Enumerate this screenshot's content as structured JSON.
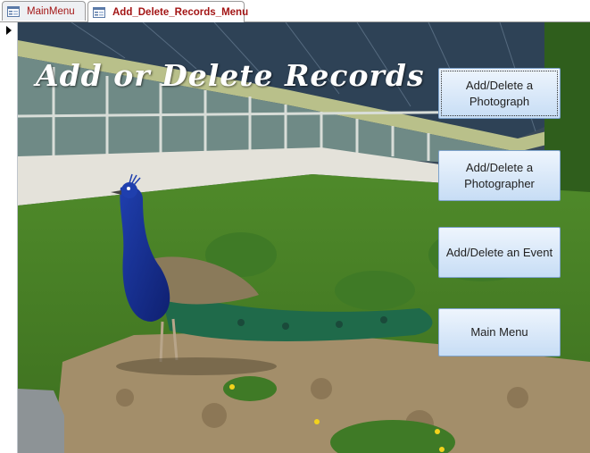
{
  "tabs": [
    {
      "label": "MainMenu",
      "active": false
    },
    {
      "label": "Add_Delete_Records_Menu",
      "active": true
    }
  ],
  "form": {
    "title": "Add or Delete Records",
    "buttons": {
      "photograph": "Add/Delete a Photograph",
      "photographer": "Add/Delete a Photographer",
      "event": "Add/Delete an Event",
      "main_menu": "Main Menu"
    },
    "focused_button": "photograph",
    "background_image": "peacock-in-garden-photo"
  },
  "icons": {
    "tab_icon": "form-icon",
    "record_selector": "current-record-arrow-icon"
  },
  "colors": {
    "tab_text": "#a31515",
    "button_border": "#7ea3cc",
    "title_text": "#ffffff"
  }
}
